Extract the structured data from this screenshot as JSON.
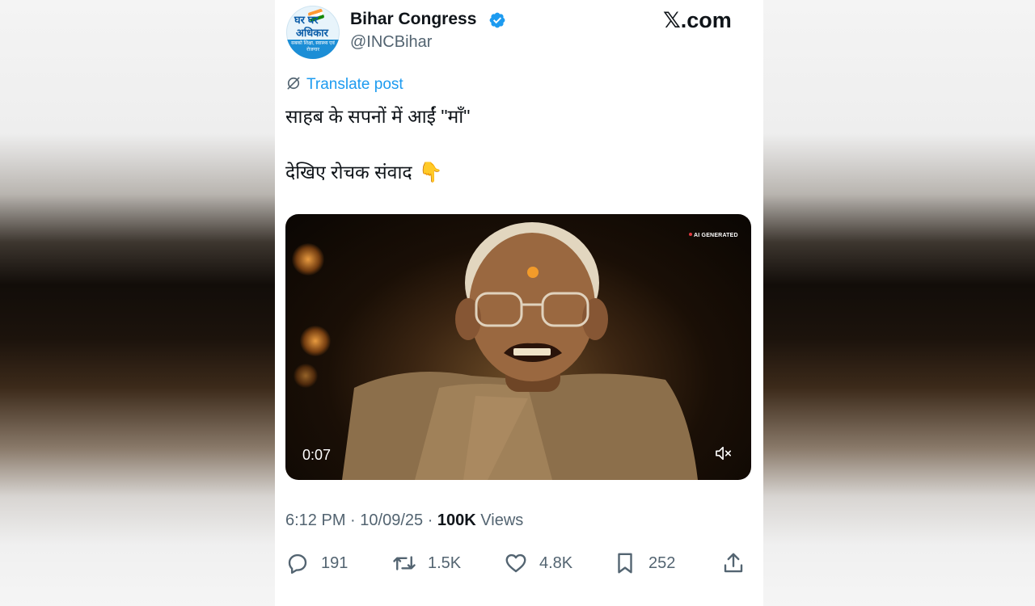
{
  "header": {
    "account_name": "Bihar Congress",
    "handle": "@INCBihar",
    "site_label": "𝕏.com",
    "avatar": {
      "line1": "घर घर",
      "line2": "अधिकार",
      "line3": "सबको शिक्षा, स्वास्थ्य एवं रोजगार"
    }
  },
  "post": {
    "translate_label": "Translate post",
    "line1": "साहब के सपनों में आईं \"माँ\"",
    "line2": "देखिए रोचक संवाद",
    "emoji": "👇"
  },
  "video": {
    "badge": "AI GENERATED",
    "timecode": "0:07"
  },
  "meta": {
    "time": "6:12 PM",
    "date": "10/09/25",
    "views_count": "100K",
    "views_label": "Views"
  },
  "actions": {
    "replies": "191",
    "reposts": "1.5K",
    "likes": "4.8K",
    "bookmarks": "252"
  },
  "colors": {
    "accent": "#1d9bf0",
    "text": "#0f1419",
    "muted": "#536471"
  }
}
